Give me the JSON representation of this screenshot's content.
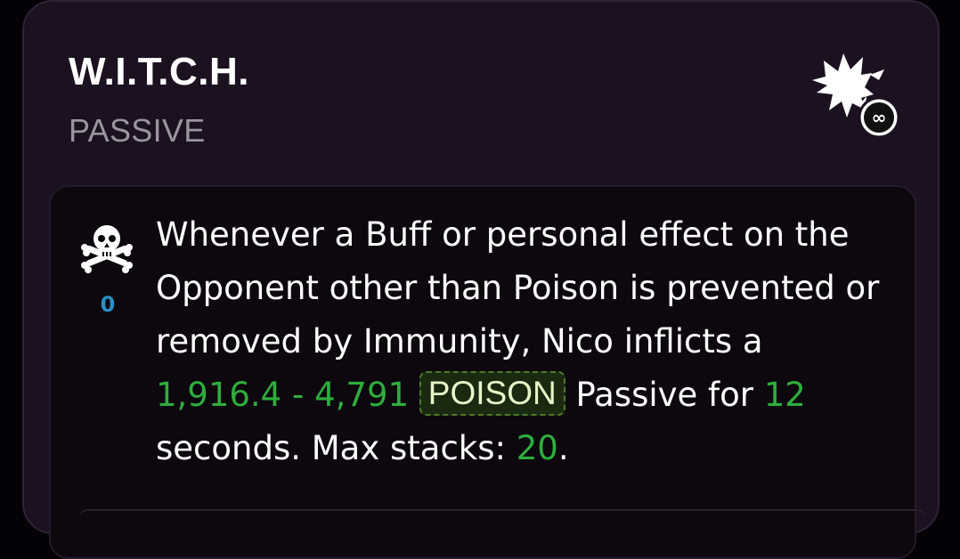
{
  "card": {
    "title": "W.I.T.C.H.",
    "type_label": "PASSIVE",
    "corner_icon": "burst-infinity-icon"
  },
  "effect": {
    "icon": "skull-crossbones-icon",
    "stack_count": "0",
    "text_1": "Whenever a Buff or personal effect on the Opponent other than Poison is prevented or removed by Immunity, Nico inflicts a ",
    "damage_range": "1,916.4 - 4,791",
    "badge_label": "POISON",
    "text_2": " Passive for ",
    "duration": "12",
    "text_3": " seconds. Max stacks: ",
    "max_stacks": "20",
    "text_4": "."
  },
  "colors": {
    "card_bg": "#1b1120",
    "inner_bg": "#0c080e",
    "highlight_green": "#2eae3c",
    "stack_blue": "#2a8fc4",
    "subtitle_gray": "#9a94a0"
  }
}
